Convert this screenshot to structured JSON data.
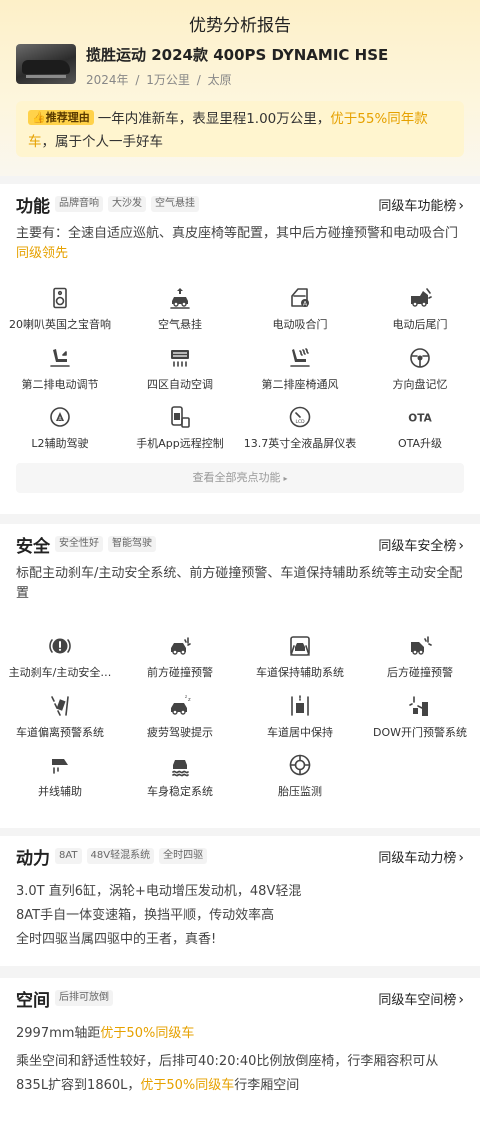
{
  "page": {
    "title": "优势分析报告"
  },
  "car": {
    "name": "揽胜运动 2024款 400PS DYNAMIC HSE",
    "year": "2024年",
    "mileage": "1万公里",
    "city": "太原",
    "sep": "/"
  },
  "reason": {
    "tag": "推荐理由",
    "text1": "一年内准新车，表显里程1.00万公里，",
    "highlight": "优于55%同年款车",
    "text2": "，属于个人一手好车"
  },
  "function": {
    "title": "功能",
    "chips": [
      "品牌音响",
      "大沙发",
      "空气悬挂"
    ],
    "rank": "同级车功能榜",
    "desc": "主要有：全速自适应巡航、真皮座椅等配置，其中后方碰撞预警和电动吸合门",
    "desc_hl": "同级领先",
    "items": [
      {
        "label": "20喇叭英国之宝音响",
        "icon": "speaker-icon"
      },
      {
        "label": "空气悬挂",
        "icon": "air-suspension-icon"
      },
      {
        "label": "电动吸合门",
        "icon": "power-door-icon"
      },
      {
        "label": "电动后尾门",
        "icon": "power-tailgate-icon"
      },
      {
        "label": "第二排电动调节",
        "icon": "seat-adjust-icon"
      },
      {
        "label": "四区自动空调",
        "icon": "climate-control-icon"
      },
      {
        "label": "第二排座椅通风",
        "icon": "seat-ventilation-icon"
      },
      {
        "label": "方向盘记忆",
        "icon": "steering-wheel-icon"
      },
      {
        "label": "L2辅助驾驶",
        "icon": "driving-assist-icon"
      },
      {
        "label": "手机App远程控制",
        "icon": "phone-remote-icon"
      },
      {
        "label": "13.7英寸全液晶屏仪表",
        "icon": "lcd-dashboard-icon"
      },
      {
        "label": "OTA升级",
        "icon": "ota-icon",
        "icon_text": "OTA"
      }
    ],
    "view_all": "查看全部亮点功能"
  },
  "safety": {
    "title": "安全",
    "chips": [
      "安全性好",
      "智能驾驶"
    ],
    "rank": "同级车安全榜",
    "desc": "标配主动刹车/主动安全系统、前方碰撞预警、车道保持辅助系统等主动安全配置",
    "items": [
      {
        "label": "主动刹车/主动安全…",
        "icon": "brake-warning-icon"
      },
      {
        "label": "前方碰撞预警",
        "icon": "front-collision-icon"
      },
      {
        "label": "车道保持辅助系统",
        "icon": "lane-keep-icon"
      },
      {
        "label": "后方碰撞预警",
        "icon": "rear-collision-icon"
      },
      {
        "label": "车道偏离预警系统",
        "icon": "lane-departure-icon"
      },
      {
        "label": "疲劳驾驶提示",
        "icon": "fatigue-icon"
      },
      {
        "label": "车道居中保持",
        "icon": "lane-center-icon"
      },
      {
        "label": "DOW开门预警系统",
        "icon": "door-open-warning-icon"
      },
      {
        "label": "并线辅助",
        "icon": "blind-spot-icon"
      },
      {
        "label": "车身稳定系统",
        "icon": "stability-icon"
      },
      {
        "label": "胎压监测",
        "icon": "tire-pressure-icon"
      }
    ]
  },
  "power": {
    "title": "动力",
    "chips": [
      "8AT",
      "48V轻混系统",
      "全时四驱"
    ],
    "rank": "同级车动力榜",
    "lines": [
      "3.0T 直列6缸，涡轮+电动增压发动机，48V轻混",
      "8AT手自一体变速箱，换挡平顺，传动效率高",
      "全时四驱当属四驱中的王者，真香!"
    ]
  },
  "space": {
    "title": "空间",
    "chips": [
      "后排可放倒"
    ],
    "rank": "同级车空间榜",
    "line1_a": "2997mm轴距",
    "line1_hl": "优于50%同级车",
    "line2_a": "乘坐空间和舒适性较好，后排可40:20:40比例放倒座椅，行李厢容积可从835L扩容到1860L，",
    "line2_hl": "优于50%同级车",
    "line2_b": "行李厢空间"
  },
  "colors": {
    "accent": "#e6a100",
    "tag_bg": "#ffd24a",
    "hero_bg": "#fdf0c8"
  }
}
